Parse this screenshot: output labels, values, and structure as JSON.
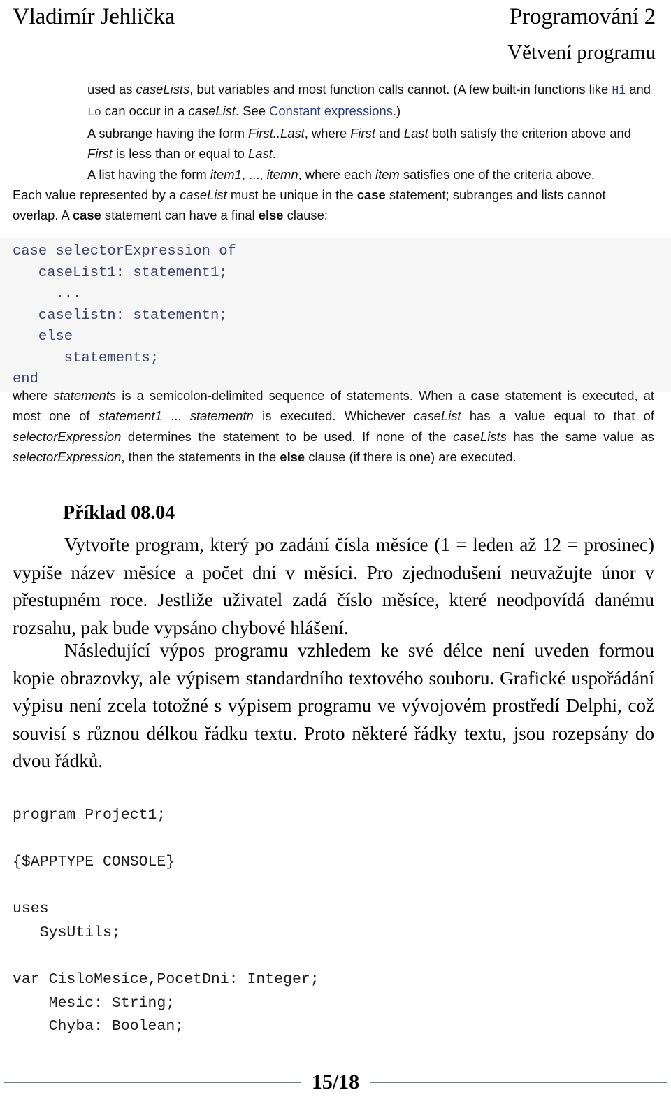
{
  "running_head": {
    "left": "Vladimír Jehlička",
    "right": "Programování 2",
    "subtitle": "Větvení programu"
  },
  "helpdoc": {
    "bullet1_part1": "used as ",
    "bullet1_caselists": "caseLists",
    "bullet1_part2": ", but variables and most function calls cannot. (A few built-in functions like ",
    "bullet1_hi": "Hi",
    "bullet1_and": " and ",
    "bullet1_lo": "Lo",
    "bullet1_part3": " can occur in a ",
    "bullet1_caselist": "caseList",
    "bullet1_part4": ". See ",
    "bullet1_link": "Constant expressions",
    "bullet1_part5": ".)",
    "bullet2_part1": "A subrange having the form ",
    "bullet2_firstlast": "First..Last",
    "bullet2_part2": ", where ",
    "bullet2_first": "First",
    "bullet2_part3": " and ",
    "bullet2_last": "Last",
    "bullet2_part4": " both satisfy the criterion above and ",
    "bullet2_first2": "First",
    "bullet2_part5": " is less than or equal to ",
    "bullet2_last2": "Last",
    "bullet2_part6": ".",
    "bullet3_part1": "A list having the form ",
    "bullet3_item1": "item1",
    "bullet3_part2": ", ..., ",
    "bullet3_itemn": "itemn",
    "bullet3_part3": ", where each ",
    "bullet3_item": "item",
    "bullet3_part4": " satisfies one of the criteria above.",
    "para_part1": "Each value represented by a ",
    "para_caselist": "caseList",
    "para_part2": " must be unique in the ",
    "para_case1": "case",
    "para_part3": " statement; subranges and lists cannot overlap. A ",
    "para_case2": "case",
    "para_part4": " statement can have a final ",
    "para_else": "else",
    "para_part5": " clause:"
  },
  "code_syntax": {
    "lines": [
      "case selectorExpression of",
      "   caseList1: statement1;",
      "     ...",
      "   caselistn: statementn;",
      "   else",
      "      statements;",
      "end"
    ],
    "text": "case selectorExpression of\n   caseList1: statement1;\n     ...\n   caselistn: statementn;\n   else\n      statements;\nend"
  },
  "after_code": {
    "p1": "where ",
    "statements": "statements",
    "p2": " is a semicolon-delimited sequence of statements. When a ",
    "case1": "case",
    "p3": " statement is executed, at most one of ",
    "statement1": "statement1",
    "p4": " ... ",
    "statementn": "statementn",
    "p5": " is executed. Whichever ",
    "caselist": "caseList",
    "p6": " has a value equal to that of ",
    "selexpr1": "selectorExpression",
    "p7": " determines the statement to be used. If none of the ",
    "caselists": "caseLists",
    "p8": " has the same value as ",
    "selexpr2": "selectorExpression",
    "p9": ", then the statements in the ",
    "else": "else",
    "p10": " clause (if there is one) are executed."
  },
  "example": {
    "title": "Příklad 08.04",
    "para1": "Vytvořte program, který po zadání čísla měsíce (1 = leden až 12 = prosinec) vypíše název měsíce a počet dní v měsíci. Pro zjednodušení neuvažujte únor v přestupném roce. Jestliže uživatel zadá číslo měsíce, které neodpovídá danému rozsahu, pak bude vypsáno chybové hlášení.",
    "para2": "Následující výpos programu vzhledem ke své délce není uveden formou kopie obrazovky, ale výpisem standardního textového souboru. Grafické uspořádání výpisu není zcela totožné s výpisem programu ve vývojovém prostředí Delphi, což souvisí s různou délkou řádku textu. Proto některé řádky textu, jsou rozepsány do dvou řádků."
  },
  "listing": {
    "text": "program Project1;\n\n{$APPTYPE CONSOLE}\n\nuses\n   SysUtils;\n\nvar CisloMesice,PocetDni: Integer;\n    Mesic: String;\n    Chyba: Boolean;"
  },
  "footer": {
    "page_number": "15/18"
  },
  "colors": {
    "link": "#2a3c8f",
    "code_blue": "#3b4270",
    "code_bg": "#f6f6f6",
    "rule": "#6f7f8c"
  }
}
